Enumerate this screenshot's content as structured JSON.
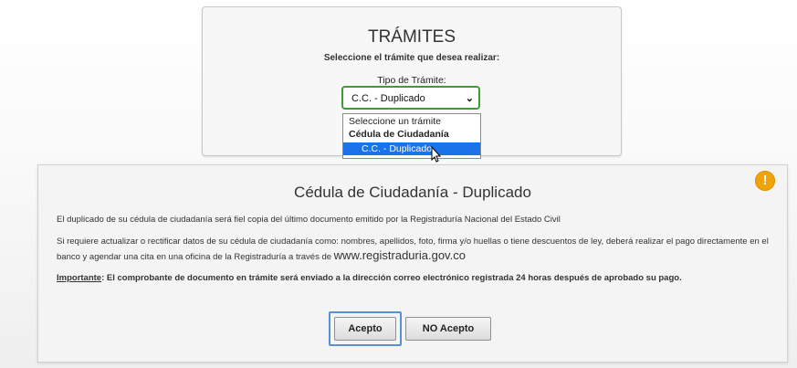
{
  "tramites": {
    "title": "TRÁMITES",
    "subtitle": "Seleccione el trámite que desea realizar:",
    "select_label": "Tipo de Trámite:",
    "selected_value": "C.C. - Duplicado",
    "options": [
      "Seleccione un trámite",
      "Cédula de Ciudadanía",
      "C.C. - Duplicado"
    ]
  },
  "modal": {
    "title": "Cédula de Ciudadanía - Duplicado",
    "paragraph1": "El duplicado de su cédula de ciudadanía será fiel copia del último documento emitido por la Registraduría Nacional del Estado Civil",
    "paragraph2": "Si requiere actualizar o rectificar datos de su cédula de ciudadanía como: nombres, apellidos, foto, firma y/o huellas o tiene descuentos de ley, deberá realizar el pago directamente en el banco y agendar una cita en una oficina de la Registraduría a través de",
    "link_text": "www.registraduria.gov.co",
    "important_label": "Importante",
    "important_text": ": El comprobante de documento en trámite será enviado a la dirección correo electrónico registrada 24 horas después de aprobado su pago.",
    "accept_label": "Acepto",
    "decline_label": "NO Acepto",
    "alert_icon": "exclamation-icon"
  }
}
